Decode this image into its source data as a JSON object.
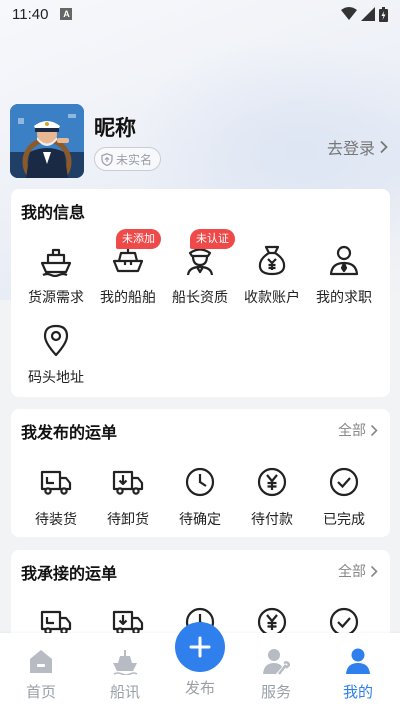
{
  "status_bar": {
    "time": "11:40",
    "notif": "A"
  },
  "profile": {
    "nickname": "昵称",
    "verify_status": "未实名",
    "login_label": "去登录"
  },
  "my_info": {
    "title": "我的信息",
    "items": [
      {
        "label": "货源需求",
        "icon": "cargo-ship-icon",
        "tag": ""
      },
      {
        "label": "我的船舶",
        "icon": "boat-icon",
        "tag": "未添加"
      },
      {
        "label": "船长资质",
        "icon": "captain-icon",
        "tag": "未认证"
      },
      {
        "label": "收款账户",
        "icon": "money-bag-icon",
        "tag": ""
      },
      {
        "label": "我的求职",
        "icon": "user-icon",
        "tag": ""
      },
      {
        "label": "码头地址",
        "icon": "location-pin-icon",
        "tag": ""
      }
    ]
  },
  "published_orders": {
    "title": "我发布的运单",
    "more_label": "全部",
    "items": [
      {
        "label": "待装货",
        "icon": "truck-load-icon"
      },
      {
        "label": "待卸货",
        "icon": "truck-unload-icon"
      },
      {
        "label": "待确定",
        "icon": "clock-icon"
      },
      {
        "label": "待付款",
        "icon": "yen-icon"
      },
      {
        "label": "已完成",
        "icon": "check-circle-icon"
      }
    ]
  },
  "accepted_orders": {
    "title": "我承接的运单",
    "more_label": "全部"
  },
  "tabbar": {
    "tabs": [
      {
        "label": "首页",
        "icon": "home-icon"
      },
      {
        "label": "船讯",
        "icon": "ship-news-icon"
      },
      {
        "label": "发布",
        "icon": "plus-icon"
      },
      {
        "label": "服务",
        "icon": "service-icon"
      },
      {
        "label": "我的",
        "icon": "profile-icon"
      }
    ],
    "active_index": 4
  },
  "colors": {
    "accent": "#2f80ed",
    "tag_red": "#ef4a4a",
    "inactive": "#9aa0a8"
  }
}
